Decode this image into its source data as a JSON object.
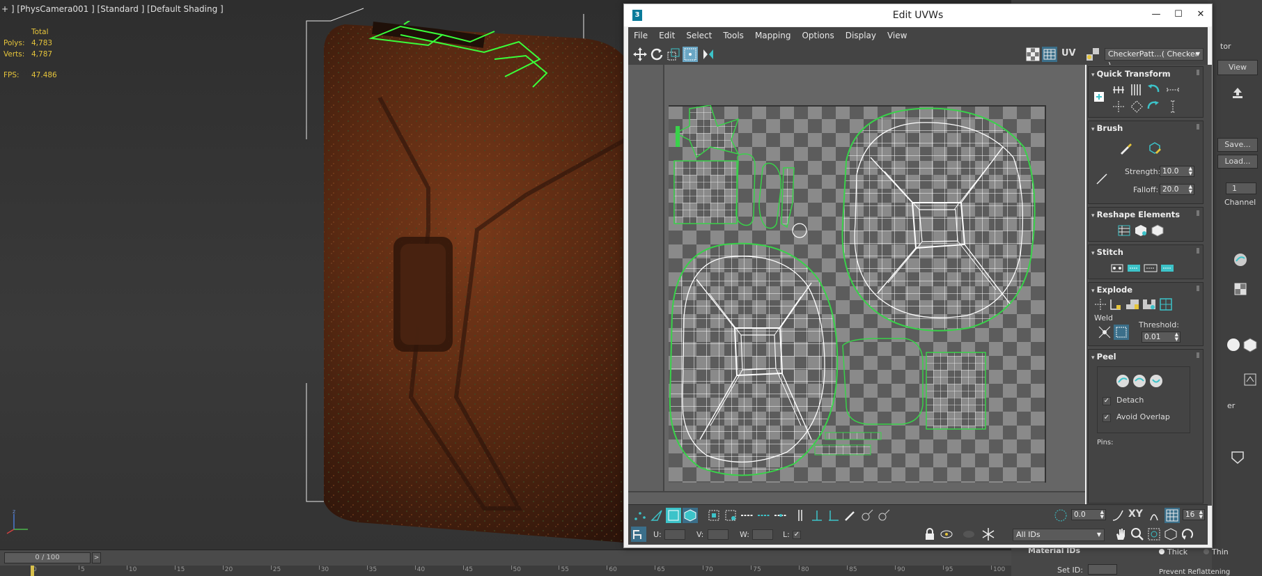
{
  "viewport": {
    "label": "+ ] [PhysCamera001 ] [Standard ] [Default Shading ]",
    "stats": {
      "total_label": "Total",
      "polys_label": "Polys:",
      "polys_value": "4,783",
      "verts_label": "Verts:",
      "verts_value": "4,787",
      "fps_label": "FPS:",
      "fps_value": "47.486"
    }
  },
  "timeline": {
    "slider_text": "0 / 100",
    "left_arrow": "<",
    "right_arrow": ">",
    "ticks": [
      "0",
      "5",
      "10",
      "15",
      "20",
      "25",
      "30",
      "35",
      "40",
      "45",
      "50",
      "55",
      "60",
      "65",
      "70",
      "75",
      "80",
      "85",
      "90",
      "95",
      "100"
    ]
  },
  "uvw_window": {
    "title": "Edit UVWs",
    "app_icon": "3",
    "window_buttons": {
      "minimize": "—",
      "maximize": "☐",
      "close": "✕"
    },
    "menu": [
      "File",
      "Edit",
      "Select",
      "Tools",
      "Mapping",
      "Options",
      "Display",
      "View"
    ],
    "uv_label": "UV",
    "checker_dropdown": "CheckerPatt...( Checker )",
    "rollouts": {
      "quick_transform": "Quick Transform",
      "brush": "Brush",
      "brush_strength_label": "Strength:",
      "brush_strength_value": "10.0",
      "brush_falloff_label": "Falloff:",
      "brush_falloff_value": "20.0",
      "reshape": "Reshape Elements",
      "stitch": "Stitch",
      "explode": "Explode",
      "weld_label": "Weld",
      "threshold_label": "Threshold:",
      "threshold_value": "0.01",
      "peel": "Peel",
      "detach_label": "Detach",
      "avoid_overlap_label": "Avoid Overlap",
      "pins_label": "Pins:"
    },
    "bottom": {
      "rotate_value": "0.0",
      "xy_label": "XY",
      "grid_value": "16",
      "u_label": "U:",
      "v_label": "V:",
      "w_label": "W:",
      "l_label": "L:",
      "all_ids": "All IDs"
    }
  },
  "command_panel": {
    "tor_label": "tor",
    "view_label": "View",
    "save_label": "Save...",
    "load_label": "Load...",
    "channel_value": "1",
    "channel_label": "Channel",
    "er_label": "er",
    "material_ids": "Material IDs",
    "set_id_label": "Set ID:",
    "thick_label": "Thick",
    "thin_label": "Thin",
    "prevent_label": "Prevent Reflattening"
  },
  "colors": {
    "uv_wire": "#ffffff",
    "uv_selection": "#39d24a",
    "accent_teal": "#3cc3c9",
    "stats_yellow": "#e6c53b"
  }
}
